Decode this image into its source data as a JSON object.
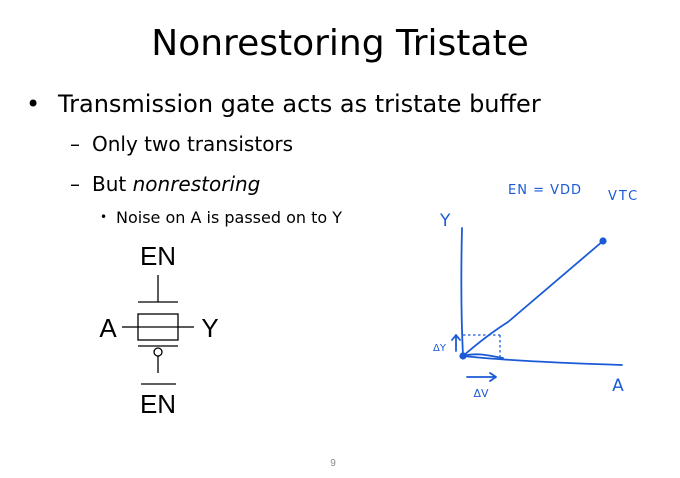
{
  "slide": {
    "title": "Nonrestoring Tristate",
    "bullets": [
      {
        "marker": "•",
        "text": "Transmission gate acts as tristate buffer"
      },
      {
        "marker": "–",
        "text": "Only two transistors"
      },
      {
        "marker": "–",
        "text_before": "But ",
        "text_emph": "nonrestoring"
      },
      {
        "marker": "•",
        "text": "Noise on A is passed on to Y"
      }
    ],
    "page_number": "9"
  },
  "schematic": {
    "enable_top": "EN",
    "input": "A",
    "output": "Y",
    "enable_bottom": "EN"
  },
  "sketch": {
    "color": "#1a5ad7",
    "condition": "EN = VDD",
    "plot_label": "VTC",
    "y_axis_label": "Y",
    "x_axis_label": "A",
    "delta_y_label": "ΔY",
    "delta_x_label": "ΔV"
  }
}
